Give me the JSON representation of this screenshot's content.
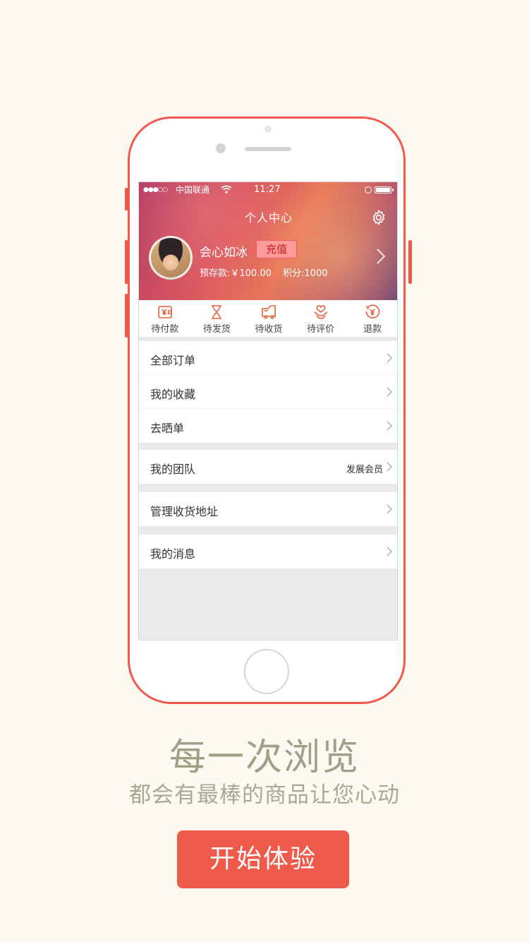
{
  "status_bar": {
    "signal": "●●●○○",
    "carrier": "中国联通",
    "time": "11:27"
  },
  "header": {
    "title": "个人中心",
    "username": "会心如冰",
    "recharge_label": "充值",
    "deposit": "预存款:￥100.00",
    "points": "积分:1000"
  },
  "order_tabs": [
    {
      "label": "待付款",
      "icon": "wallet-yen-icon"
    },
    {
      "label": "待发货",
      "icon": "hourglass-icon"
    },
    {
      "label": "待收货",
      "icon": "truck-icon"
    },
    {
      "label": "待评价",
      "icon": "heart-hand-icon"
    },
    {
      "label": "退款",
      "icon": "refund-yen-icon"
    }
  ],
  "menu": {
    "all_orders": "全部订单",
    "favorites": "我的收藏",
    "share_order": "去晒单",
    "my_team": "我的团队",
    "develop_member": "发展会员",
    "address": "管理收货地址",
    "messages": "我的消息"
  },
  "promo": {
    "headline": "每一次浏览",
    "subline": "都会有最棒的商品让您心动",
    "start_button": "开始体验"
  },
  "colors": {
    "accent": "#f05a4a",
    "icon_orange": "#e8603c",
    "background": "#fdf9f1",
    "promo_text": "#a19f88"
  }
}
